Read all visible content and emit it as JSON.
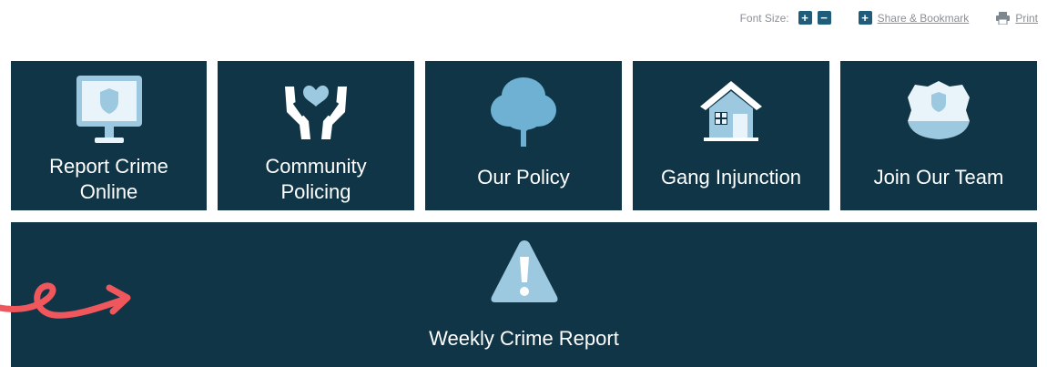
{
  "utility": {
    "font_size_label": "Font Size:",
    "increase_symbol": "+",
    "decrease_symbol": "−",
    "share_label": "Share & Bookmark",
    "print_label": "Print"
  },
  "tiles": [
    {
      "label_line1": "Report Crime",
      "label_line2": "Online",
      "icon": "computer-shield-icon"
    },
    {
      "label_line1": "Community",
      "label_line2": "Policing",
      "icon": "hands-heart-icon"
    },
    {
      "label": "Our Policy",
      "icon": "tree-icon"
    },
    {
      "label": "Gang Injunction",
      "icon": "house-icon"
    },
    {
      "label": "Join Our Team",
      "icon": "police-badge-icon"
    },
    {
      "label": "Weekly Crime Report",
      "icon": "warning-icon"
    }
  ],
  "colors": {
    "tile_bg": "#0f3547",
    "icon_light": "#9cc9e0",
    "accent_arrow": "#f0575c",
    "utility_button": "#1f5d7a"
  }
}
